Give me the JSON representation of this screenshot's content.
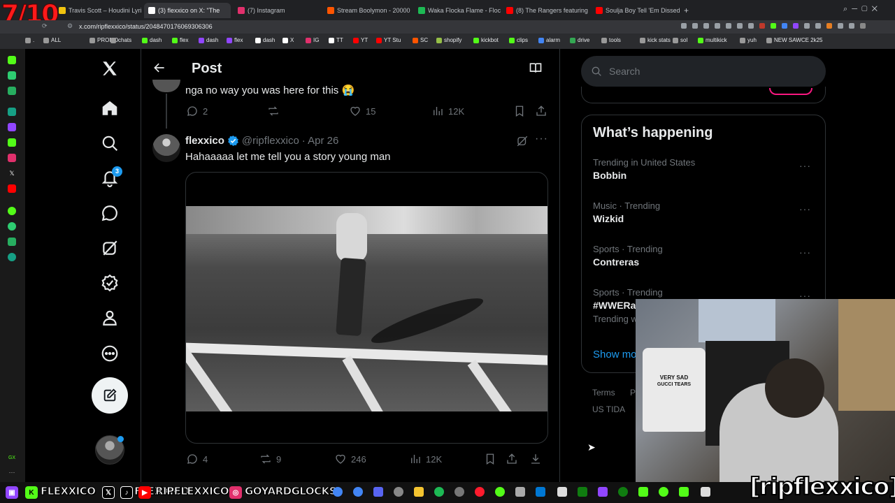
{
  "overlay": {
    "rating": "7/10",
    "brand_tag": "[ripflexxico]"
  },
  "browser": {
    "tabs": [
      {
        "title": "Travis Scott – Houdini Lyrics",
        "color": "#f1c40f"
      },
      {
        "title": "(3) flexxico on X: \"The",
        "color": "#ffffff",
        "active": true
      },
      {
        "title": "(7) Instagram",
        "color": "#e1306c"
      },
      {
        "title": "Stream Boolymon - 20000",
        "color": "#ff5500"
      },
      {
        "title": "Waka Flocka Flame - Flock",
        "color": "#1db954"
      },
      {
        "title": "(8) The Rangers featuring",
        "color": "#ff0000"
      },
      {
        "title": "Soulja Boy Tell 'Em Dissed",
        "color": "#ff0000"
      }
    ],
    "url": "x.com/ripflexxico/status/2048470176069306306",
    "bookmarks": [
      {
        "label": ".",
        "color": "#999"
      },
      {
        "label": "ALL",
        "color": "#999"
      },
      {
        "label": "PROMO",
        "color": "#999"
      },
      {
        "label": "chats",
        "color": "#999"
      },
      {
        "label": "dash",
        "color": "#53fc18"
      },
      {
        "label": "flex",
        "color": "#53fc18"
      },
      {
        "label": "dash",
        "color": "#9146ff"
      },
      {
        "label": "flex",
        "color": "#9146ff"
      },
      {
        "label": "dash",
        "color": "#fff"
      },
      {
        "label": "X",
        "color": "#fff"
      },
      {
        "label": "IG",
        "color": "#e1306c"
      },
      {
        "label": "TT",
        "color": "#fff"
      },
      {
        "label": "YT",
        "color": "#ff0000"
      },
      {
        "label": "YT Stu",
        "color": "#ff0000"
      },
      {
        "label": "SC",
        "color": "#ff5500"
      },
      {
        "label": "shopify",
        "color": "#95bf47"
      },
      {
        "label": "kickbot",
        "color": "#53fc18"
      },
      {
        "label": "clips",
        "color": "#53fc18"
      },
      {
        "label": "alarm",
        "color": "#4285f4"
      },
      {
        "label": "drive",
        "color": "#34a853"
      },
      {
        "label": "tools",
        "color": "#999"
      },
      {
        "label": "kick stats",
        "color": "#999"
      },
      {
        "label": "sol",
        "color": "#999"
      },
      {
        "label": "multikick",
        "color": "#53fc18"
      },
      {
        "label": "yuh",
        "color": "#999"
      },
      {
        "label": "NEW SAWCE 2k25",
        "color": "#999"
      }
    ]
  },
  "nav": {
    "notification_count": "3",
    "icons": [
      "x-logo-icon",
      "home-icon",
      "search-icon",
      "notifications-icon",
      "messages-icon",
      "grok-icon",
      "verified-icon",
      "profile-icon",
      "more-icon",
      "compose-icon"
    ]
  },
  "post_header": {
    "title": "Post"
  },
  "prev_tweet": {
    "text": "nga no way you was here for this 😭",
    "replies": "2",
    "likes": "15",
    "views": "12K"
  },
  "tweet": {
    "name": "flexxico",
    "handle": "@ripflexxico",
    "date": "· Apr 26",
    "text": "Hahaaaaa let me tell you a story young man",
    "replies": "4",
    "reposts": "9",
    "likes": "246",
    "views": "12K"
  },
  "search": {
    "placeholder": "Search"
  },
  "happening": {
    "title": "What’s happening",
    "trends": [
      {
        "meta": "Trending in United States",
        "name": "Bobbin"
      },
      {
        "meta": "Music · Trending",
        "name": "Wizkid"
      },
      {
        "meta": "Sports · Trending",
        "name": "Contreras"
      },
      {
        "meta": "Sports · Trending",
        "name": "#WWERa",
        "sub": "Trending w"
      }
    ],
    "show_more": "Show mo"
  },
  "footer": {
    "terms": "Terms",
    "p": "P",
    "us_tida": "US TIDA"
  },
  "webcam": {
    "shirt_text_1": "VERY SAD",
    "shirt_text_2": "GUCCI TEARS"
  },
  "taskbar": {
    "kick": "FLEXXICO",
    "x": "FLEXXICO",
    "youtube": "RIPFLEXXICO",
    "instagram": "GOYARDGLOCKS"
  }
}
